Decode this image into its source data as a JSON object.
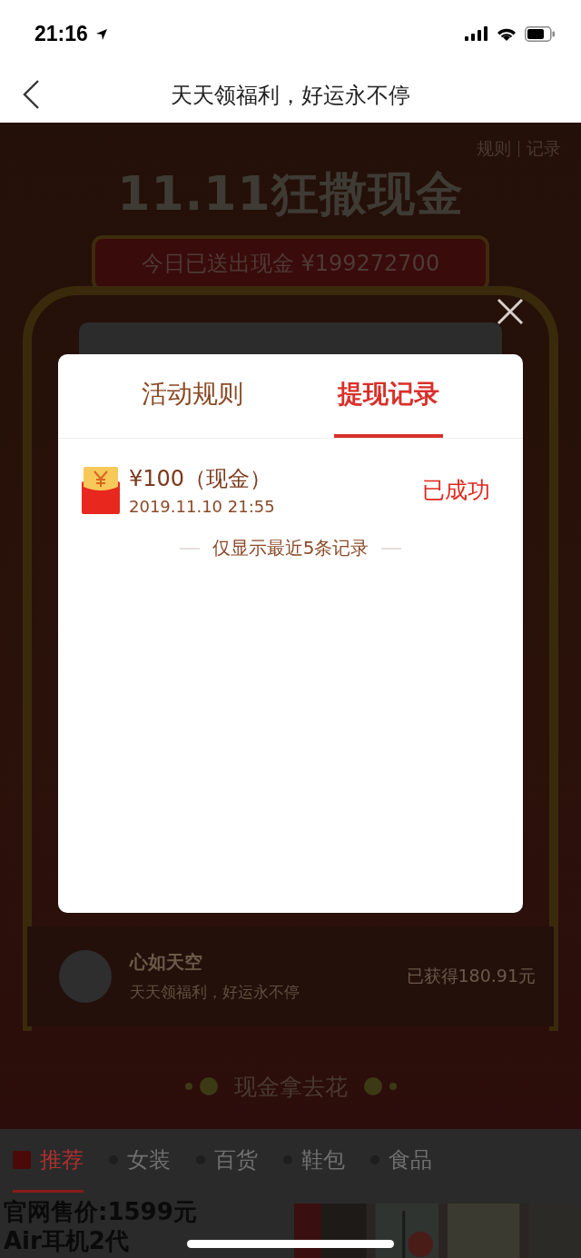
{
  "status_bar": {
    "time": "21:16"
  },
  "nav": {
    "title": "天天领福利，好运永不停"
  },
  "page": {
    "links": [
      "规则",
      "记录"
    ],
    "title": "11.11狂撒现金",
    "banner": "今日已送出现金 ¥199272700",
    "user": {
      "name": "心如天空",
      "motto": "天天领福利，好运永不停",
      "earned": "已获得180.91元"
    },
    "footer": "现金拿去花",
    "category_tabs": [
      {
        "label": "推荐",
        "selected": true
      },
      {
        "label": "女装",
        "selected": false
      },
      {
        "label": "百货",
        "selected": false
      },
      {
        "label": "鞋包",
        "selected": false
      },
      {
        "label": "食品",
        "selected": false
      }
    ],
    "product": {
      "price": "官网售价:1599元",
      "name": "Air耳机2代"
    }
  },
  "dialog": {
    "tabs": [
      {
        "label": "活动规则",
        "selected": false
      },
      {
        "label": "提现记录",
        "selected": true
      }
    ],
    "records": [
      {
        "amount": "¥100（现金）",
        "time": "2019.11.10 21:55",
        "status": "已成功"
      }
    ],
    "note": "仅显示最近5条记录"
  }
}
